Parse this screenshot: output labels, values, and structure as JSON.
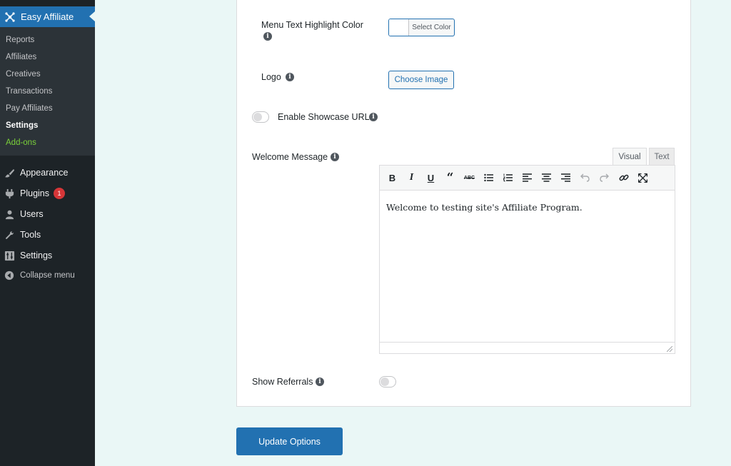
{
  "sidebar": {
    "active_plugin": {
      "label": "Easy Affiliate",
      "icon": "easy-affiliate-icon"
    },
    "submenu": [
      {
        "label": "Reports"
      },
      {
        "label": "Affiliates"
      },
      {
        "label": "Creatives"
      },
      {
        "label": "Transactions"
      },
      {
        "label": "Pay Affiliates"
      },
      {
        "label": "Settings",
        "current": true
      },
      {
        "label": "Add-ons"
      }
    ],
    "menu": [
      {
        "label": "Appearance",
        "icon": "paintbrush-icon"
      },
      {
        "label": "Plugins",
        "icon": "plug-icon",
        "badge": "1"
      },
      {
        "label": "Users",
        "icon": "user-icon"
      },
      {
        "label": "Tools",
        "icon": "wrench-icon"
      },
      {
        "label": "Settings",
        "icon": "settings-icon"
      }
    ],
    "collapse_label": "Collapse menu"
  },
  "form": {
    "menu_text_highlight": {
      "label": "Menu Text Highlight Color",
      "button": "Select Color"
    },
    "logo": {
      "label": "Logo",
      "button": "Choose Image"
    },
    "showcase": {
      "label": "Enable Showcase URL",
      "enabled": false
    },
    "welcome": {
      "label": "Welcome Message",
      "tabs": {
        "visual": "Visual",
        "text": "Text"
      },
      "content": "Welcome to testing site's Affiliate Program."
    },
    "show_referrals": {
      "label": "Show Referrals",
      "enabled": false
    }
  },
  "update_button": "Update Options",
  "colors": {
    "sidebar": "#1d2327",
    "accent": "#2271b1",
    "background": "#eaf7f6"
  }
}
